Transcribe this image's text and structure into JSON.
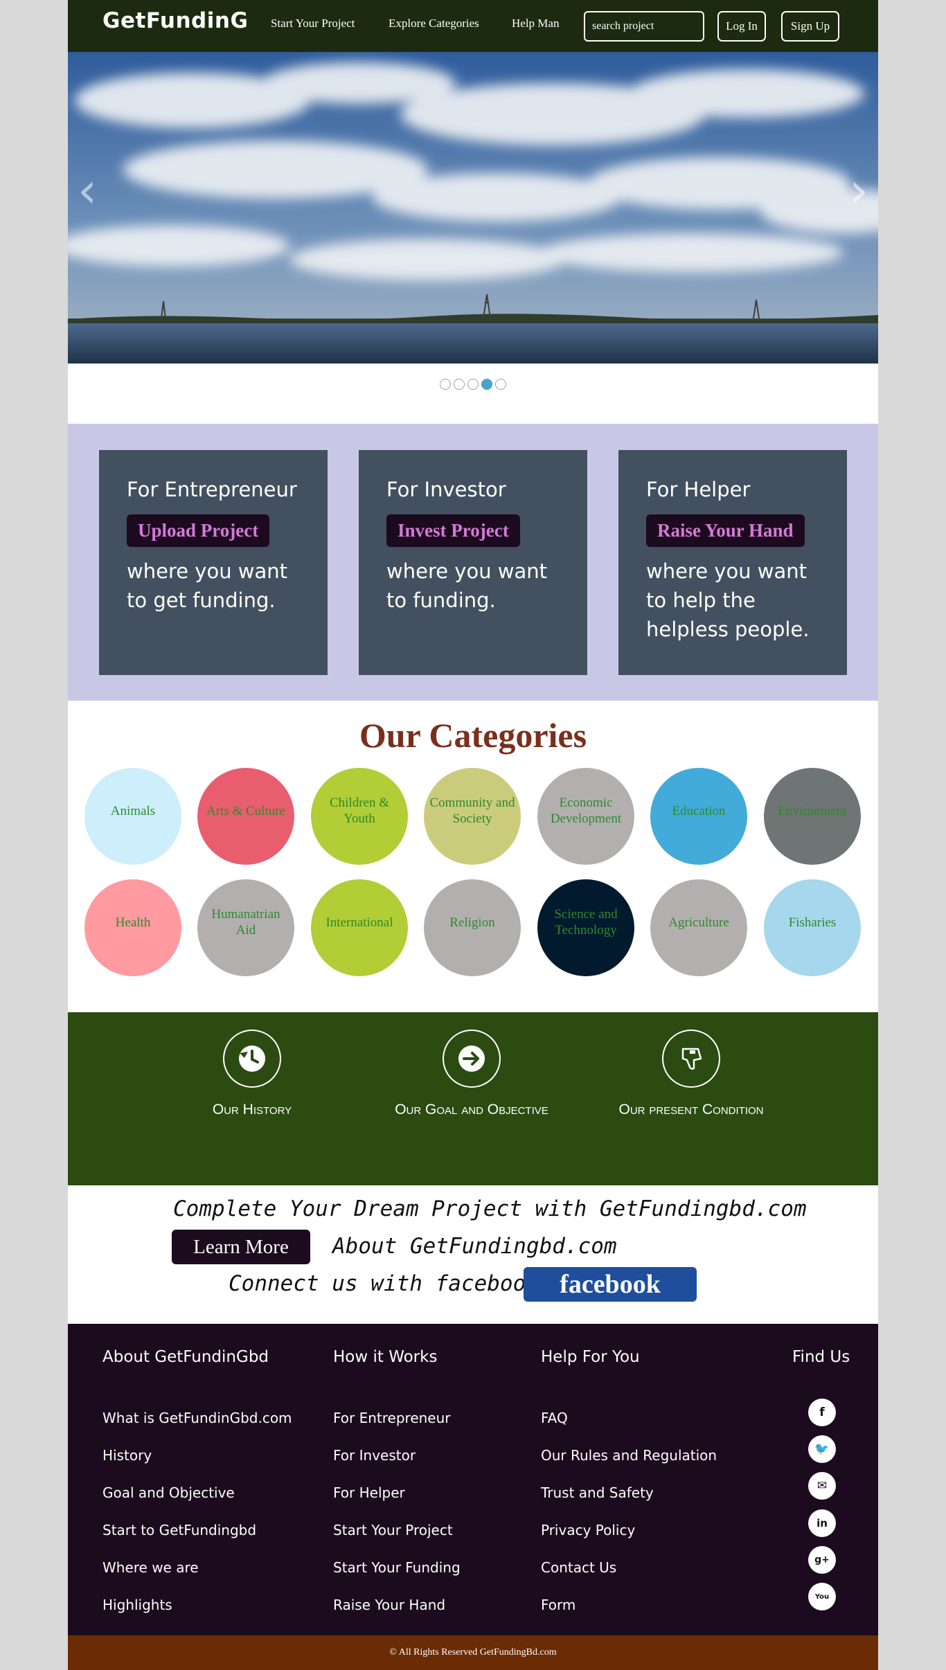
{
  "brand": "GetFundinG",
  "nav": {
    "links": [
      "Start Your Project",
      "Explore Categories",
      "Help Man"
    ],
    "search_placeholder": "search project",
    "login": "Log In",
    "signup": "Sign Up"
  },
  "carousel": {
    "prev_icon": "chevron-left-icon",
    "next_icon": "chevron-right-icon",
    "slide_count": 5,
    "active_slide": 4
  },
  "roles": [
    {
      "title": "For Entrepreneur",
      "button": "Upload Project",
      "desc": "where you want to get funding."
    },
    {
      "title": "For Investor",
      "button": "Invest Project",
      "desc": "where you want to funding."
    },
    {
      "title": "For Helper",
      "button": "Raise Your Hand",
      "desc": "where you want to help the helpless people."
    }
  ],
  "categories": {
    "title": "Our Categories",
    "items": [
      {
        "label": "Animals",
        "color": "#cdeefb"
      },
      {
        "label": "Arts & Culture",
        "color": "#e85e6f"
      },
      {
        "label": "Children & Youth",
        "color": "#b2cd35"
      },
      {
        "label": "Community and Society",
        "color": "#cbcb7c"
      },
      {
        "label": "Economic Development",
        "color": "#b3afaf"
      },
      {
        "label": "Education",
        "color": "#42abd9"
      },
      {
        "label": "Environment",
        "color": "#6f7474"
      },
      {
        "label": "Health",
        "color": "#ff9aa1"
      },
      {
        "label": "Humanatrian Aid",
        "color": "#b3afaf"
      },
      {
        "label": "International",
        "color": "#b2cd35"
      },
      {
        "label": "Religion",
        "color": "#b3afaf"
      },
      {
        "label": "Science and Technology",
        "color": "#011a2e"
      },
      {
        "label": "Agriculture",
        "color": "#b3afaf"
      },
      {
        "label": "Fisharies",
        "color": "#a6d7ec"
      }
    ]
  },
  "info": [
    {
      "label": "Our History",
      "icon": "history-icon"
    },
    {
      "label": "Our Goal and Objective",
      "icon": "arrow-right-circle-icon"
    },
    {
      "label": "Our present Condition",
      "icon": "thumbs-down-icon"
    }
  ],
  "promo": {
    "line1": "Complete Your Dream Project with GetFundingbd.com",
    "learn_more": "Learn More",
    "about": "About GetFundingbd.com",
    "connect": "Connect us with facebook",
    "facebook": "facebook"
  },
  "footer": {
    "columns": [
      {
        "heading": "About GetFundinGbd",
        "links": [
          "What is GetFundinGbd.com",
          "History",
          "Goal and Objective",
          "Start to GetFundingbd",
          "Where we are",
          "Highlights"
        ]
      },
      {
        "heading": "How it Works",
        "links": [
          "For Entrepreneur",
          "For Investor",
          "For Helper",
          "Start Your Project",
          "Start Your Funding",
          "Raise Your Hand"
        ]
      },
      {
        "heading": "Help For You",
        "links": [
          "FAQ",
          "Our Rules and Regulation",
          "Trust and Safety",
          "Privacy Policy",
          "Contact Us",
          "Form"
        ]
      }
    ],
    "find_us": "Find Us",
    "social": [
      {
        "icon": "facebook-icon",
        "glyph": "f"
      },
      {
        "icon": "twitter-icon",
        "glyph": "🐦"
      },
      {
        "icon": "email-icon",
        "glyph": "✉"
      },
      {
        "icon": "linkedin-icon",
        "glyph": "in"
      },
      {
        "icon": "google-plus-icon",
        "glyph": "g+"
      },
      {
        "icon": "youtube-icon",
        "glyph": "You"
      }
    ],
    "copyright": "© All Rights Reserved GetFundingBd.com"
  },
  "colors": {
    "navbar": "#1c2a0f",
    "roles_bg": "#c8c8e6",
    "role_card": "#42505f",
    "role_button_text": "#d579d8",
    "category_title": "#7a2f1c",
    "category_text": "#2e8a2b",
    "info_bg": "#2b4b11",
    "footer_bg": "#1c0a1e",
    "copyright_bg": "#6b2b05",
    "facebook_btn": "#1e4e9c"
  }
}
